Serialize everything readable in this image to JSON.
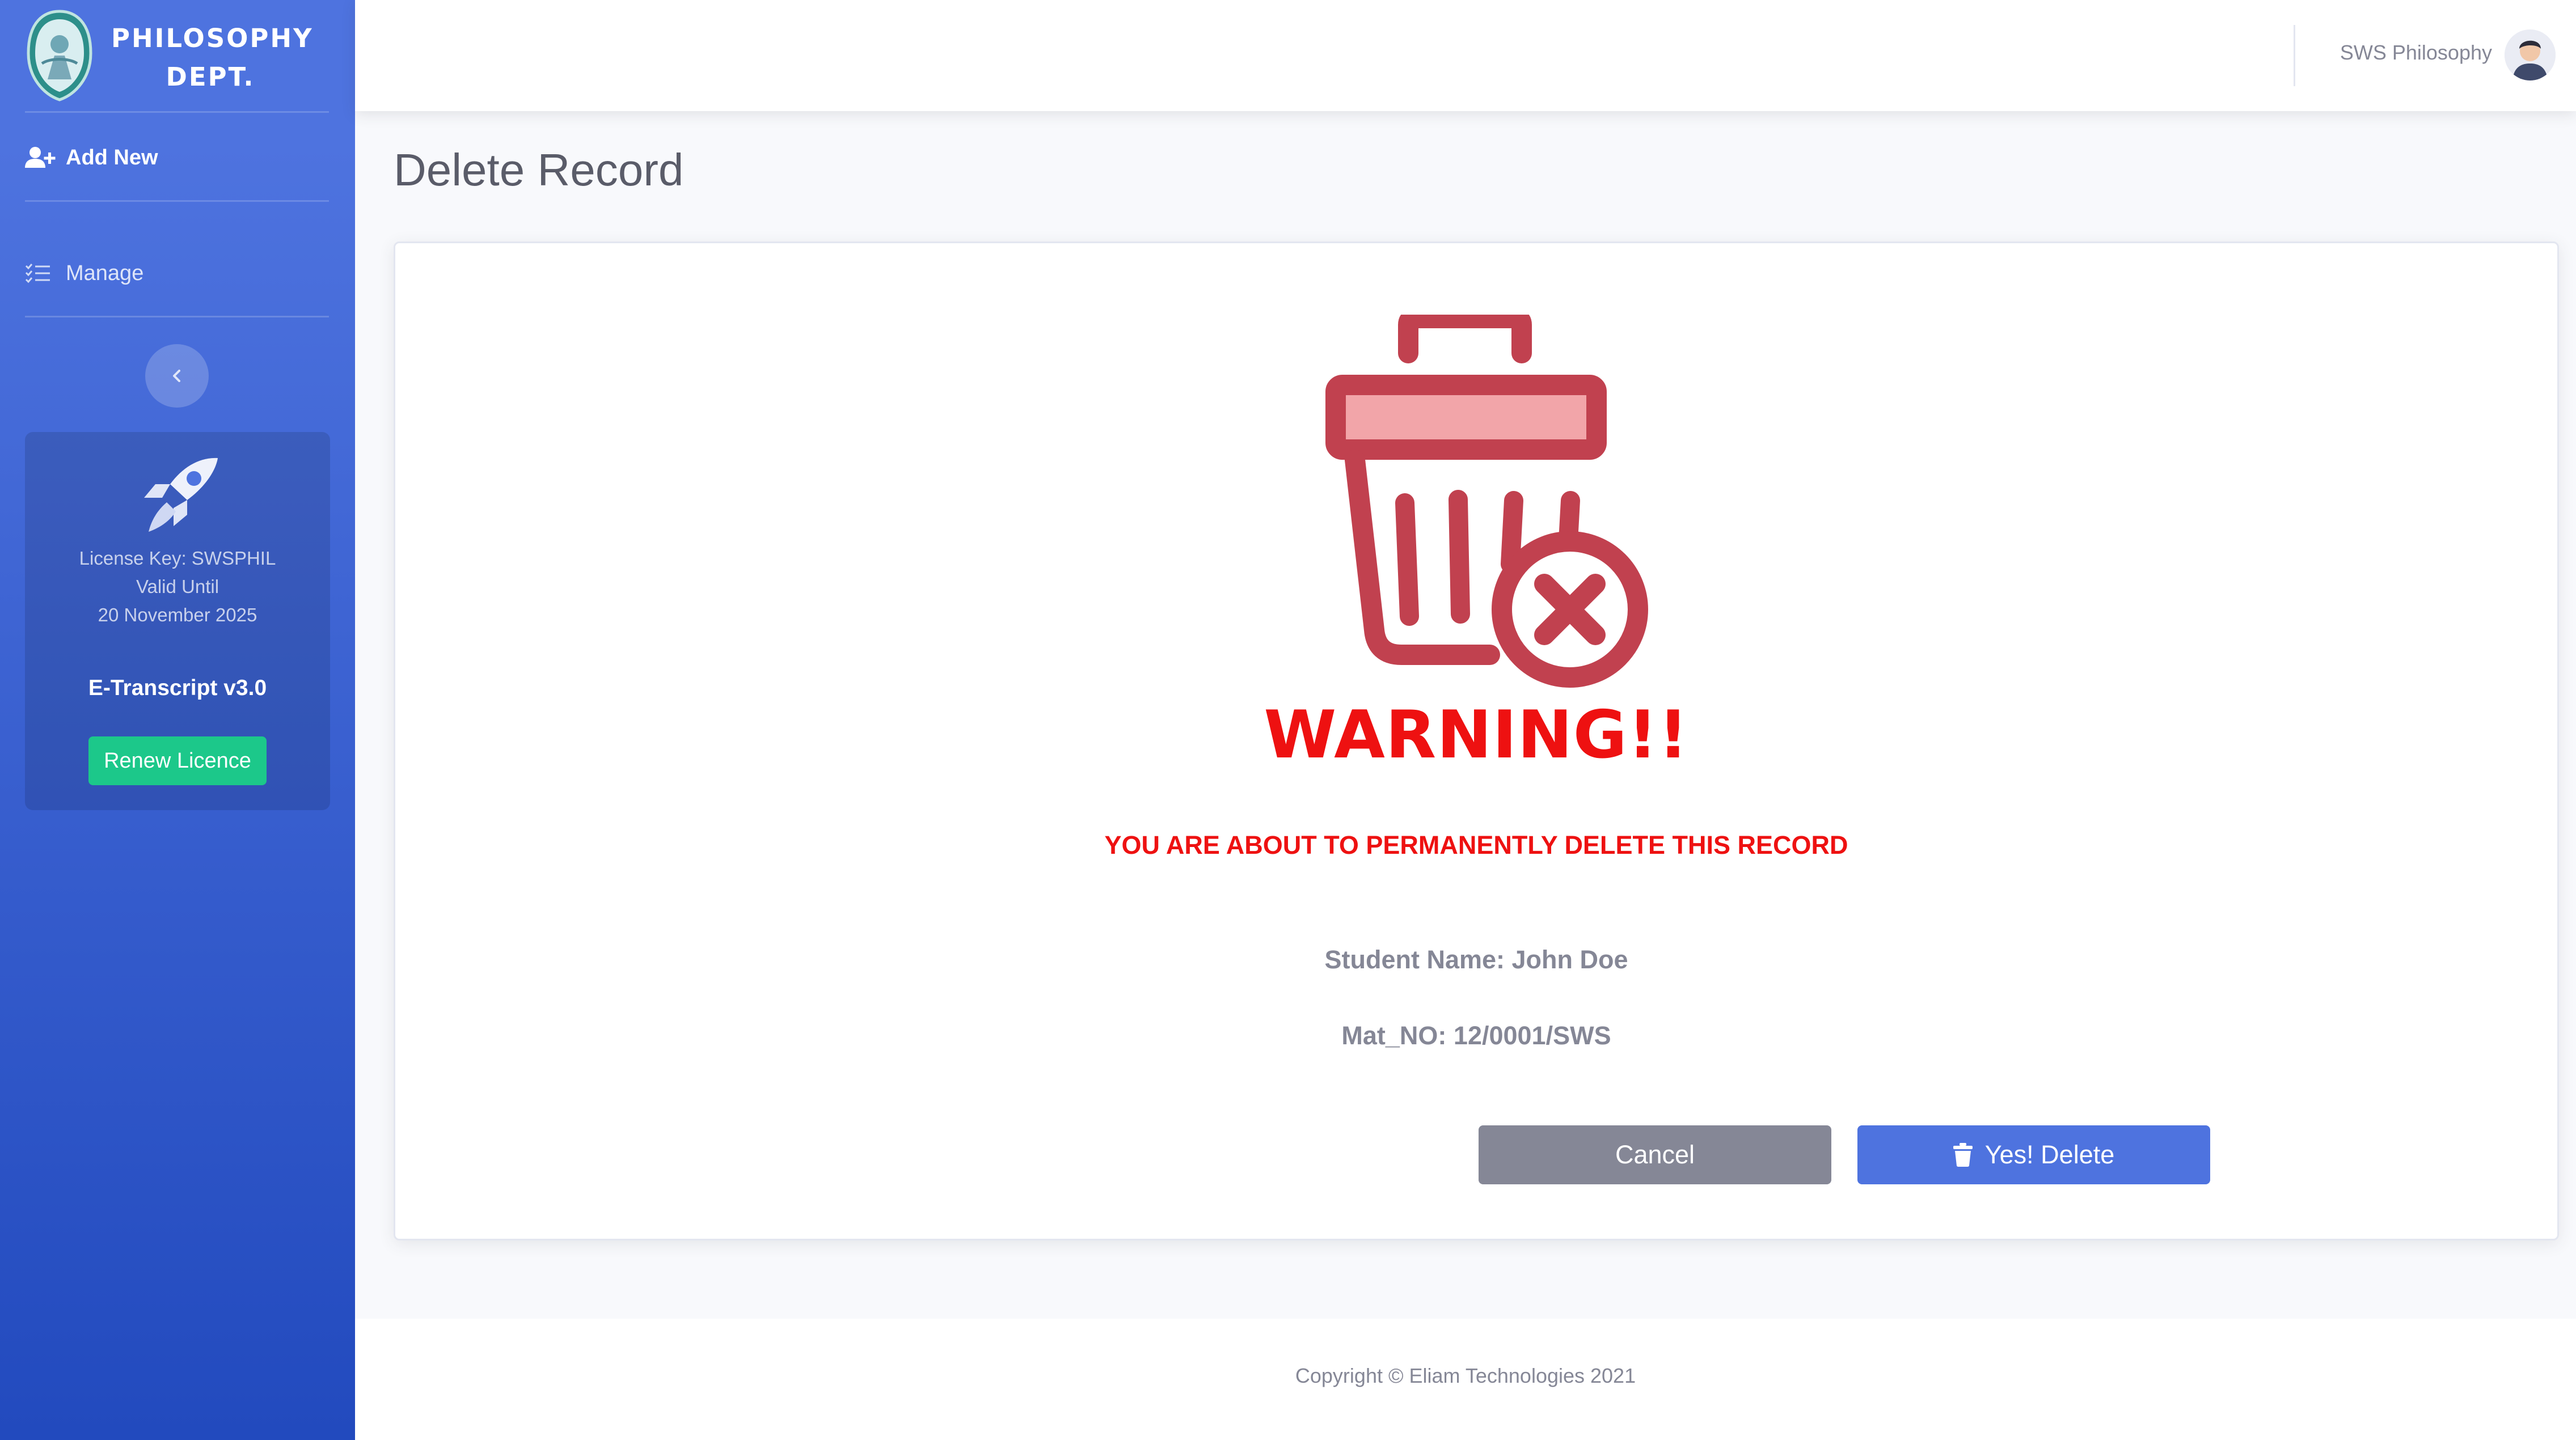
{
  "sidebar": {
    "brand_line1": "PHILOSOPHY",
    "brand_line2": "DEPT.",
    "logo_icon": "department-seal-logo",
    "nav": [
      {
        "label": "Add New",
        "icon": "user-plus-icon"
      },
      {
        "label": "Manage",
        "icon": "list-check-icon"
      }
    ],
    "toggle_icon": "chevron-left-icon",
    "license": {
      "icon": "rocket-icon",
      "key": "License Key: SWSPHIL",
      "valid": "Valid Until",
      "date": "20 November 2025",
      "version": "E-Transcript v3.0",
      "renew_label": "Renew Licence"
    }
  },
  "topbar": {
    "user_name": "SWS Philosophy",
    "avatar_icon": "user-avatar"
  },
  "main": {
    "page_title": "Delete Record",
    "illustration": "trash-delete-icon",
    "warning_title": "WARNING!!",
    "warning_message": "YOU ARE ABOUT TO PERMANENTLY DELETE THIS RECORD",
    "student_name": "Student Name: John Doe",
    "mat_no": "Mat_NO: 12/0001/SWS",
    "cancel_label": "Cancel",
    "delete_label": "Yes! Delete",
    "delete_icon": "trash-icon"
  },
  "footer": {
    "copyright": "Copyright © Eliam Technologies 2021"
  },
  "colors": {
    "sidebar_top": "#4e73df",
    "sidebar_bottom": "#224abe",
    "warning": "#ee1111",
    "trash": "#c1414f",
    "trash_lid_inner": "#f2a5a9",
    "cancel": "#858796",
    "delete": "#4e73df",
    "renew": "#1cc88a"
  }
}
